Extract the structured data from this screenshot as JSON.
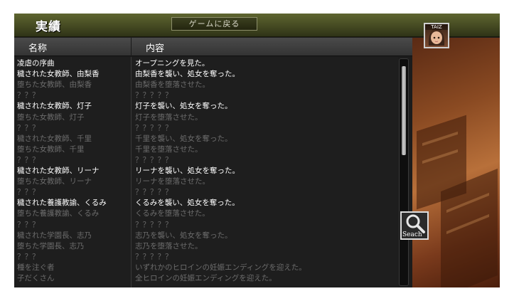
{
  "header": {
    "title": "実績",
    "back_label": "ゲームに戻る"
  },
  "columns": {
    "name": "名称",
    "content": "内容"
  },
  "rows": [
    {
      "name": "凌虐の序曲",
      "content": "オープニングを見た。",
      "unlocked": true
    },
    {
      "name": "穢された女教師、由梨香",
      "content": "由梨香を襲い、処女を奪った。",
      "unlocked": true
    },
    {
      "name": "堕ちた女教師、由梨香",
      "content": "由梨香を堕落させた。",
      "unlocked": false
    },
    {
      "name": "？？？",
      "content": "？？？？？",
      "unlocked": false
    },
    {
      "name": "穢された女教師、灯子",
      "content": "灯子を襲い、処女を奪った。",
      "unlocked": true
    },
    {
      "name": "堕ちた女教師、灯子",
      "content": "灯子を堕落させた。",
      "unlocked": false
    },
    {
      "name": "？？？",
      "content": "？？？？？",
      "unlocked": false
    },
    {
      "name": "穢された女教師、千里",
      "content": "千里を襲い、処女を奪った。",
      "unlocked": false
    },
    {
      "name": "堕ちた女教師、千里",
      "content": "千里を堕落させた。",
      "unlocked": false
    },
    {
      "name": "？？？",
      "content": "？？？？？",
      "unlocked": false
    },
    {
      "name": "穢された女教師、リーナ",
      "content": "リーナを襲い、処女を奪った。",
      "unlocked": true
    },
    {
      "name": "堕ちた女教師、リーナ",
      "content": "リーナを堕落させた。",
      "unlocked": false
    },
    {
      "name": "？？？",
      "content": "？？？？？",
      "unlocked": false
    },
    {
      "name": "穢された養護教諭、くるみ",
      "content": "くるみを襲い、処女を奪った。",
      "unlocked": true
    },
    {
      "name": "堕ちた養護教諭、くるみ",
      "content": "くるみを堕落させた。",
      "unlocked": false
    },
    {
      "name": "？？？",
      "content": "？？？？？",
      "unlocked": false
    },
    {
      "name": "穢された学園長、志乃",
      "content": "志乃を襲い、処女を奪った。",
      "unlocked": false
    },
    {
      "name": "堕ちた学園長、志乃",
      "content": "志乃を堕落させた。",
      "unlocked": false
    },
    {
      "name": "？？？",
      "content": "？？？？？",
      "unlocked": false
    },
    {
      "name": "種を注ぐ者",
      "content": "いずれかのヒロインの妊娠エンディングを迎えた。",
      "unlocked": false
    },
    {
      "name": "子だくさん",
      "content": "全ヒロインの妊娠エンディングを迎えた。",
      "unlocked": false
    }
  ],
  "portrait": {
    "label": "TAIZ"
  },
  "search": {
    "label": "Seach",
    "icon": "magnifier-icon"
  },
  "colors": {
    "header": "#454a22",
    "unlocked_text": "#ffffff",
    "locked_text": "#6c6c6c"
  }
}
